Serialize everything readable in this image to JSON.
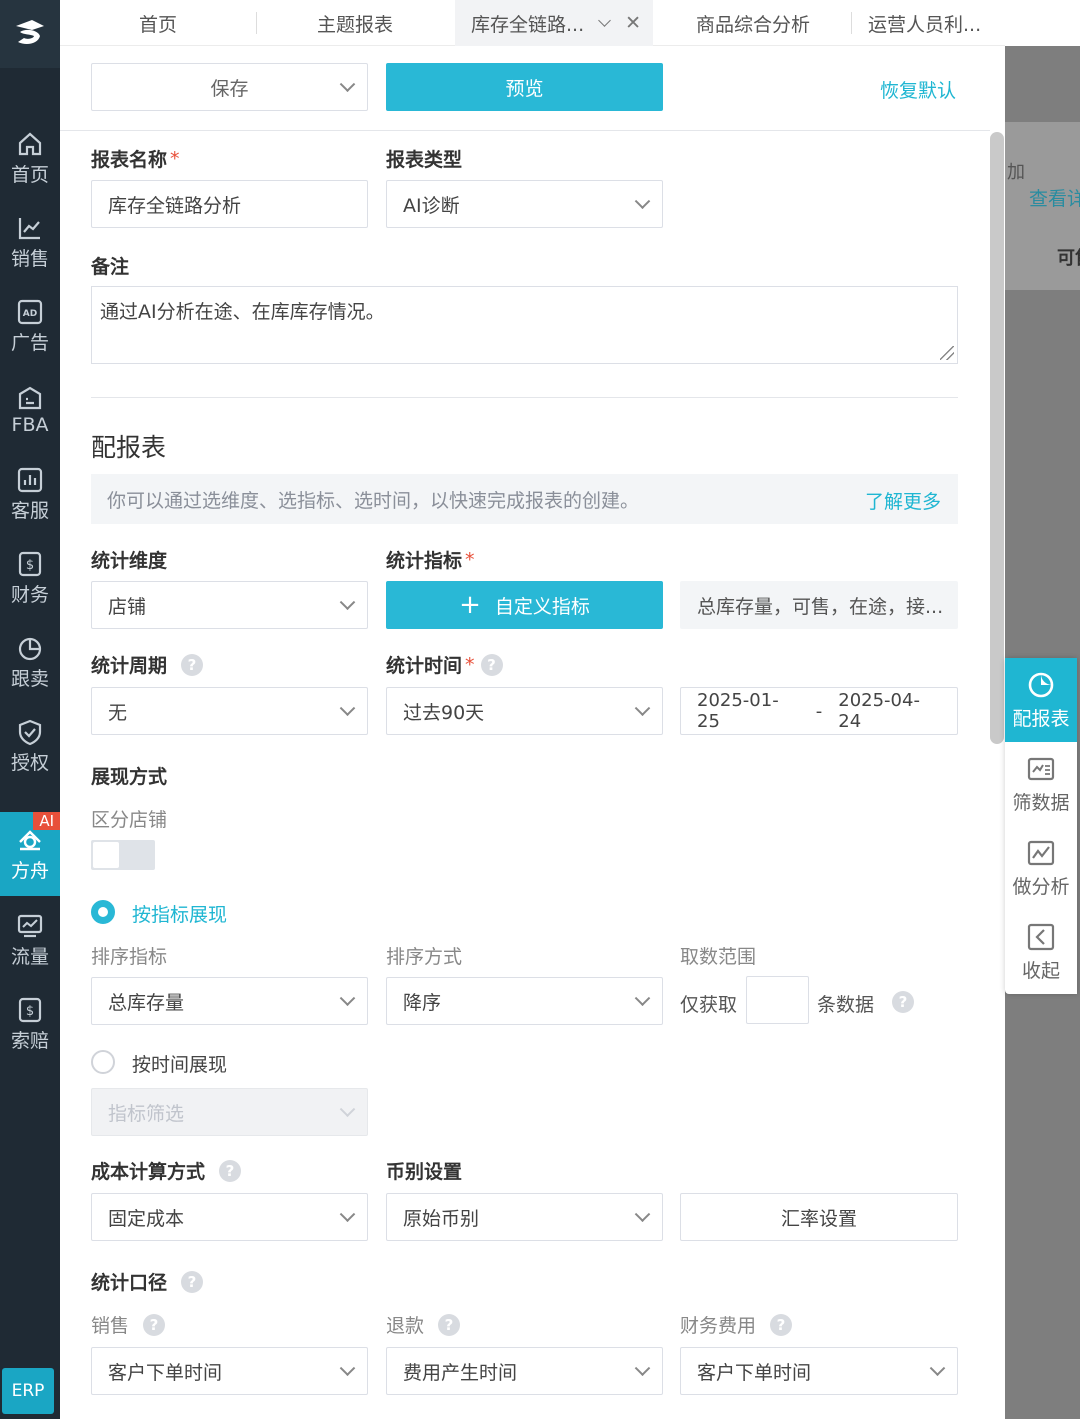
{
  "sidebar": {
    "items": [
      {
        "label": "首页",
        "icon": "home-icon"
      },
      {
        "label": "销售",
        "icon": "sales-chart-icon"
      },
      {
        "label": "广告",
        "icon": "ad-icon"
      },
      {
        "label": "FBA",
        "icon": "fba-icon"
      },
      {
        "label": "客服",
        "icon": "service-icon"
      },
      {
        "label": "财务",
        "icon": "finance-icon"
      },
      {
        "label": "跟卖",
        "icon": "pie-icon"
      },
      {
        "label": "授权",
        "icon": "shield-icon"
      },
      {
        "label": "方舟",
        "icon": "ark-icon",
        "badge": "AI"
      },
      {
        "label": "流量",
        "icon": "traffic-icon"
      },
      {
        "label": "索赔",
        "icon": "claim-icon"
      }
    ],
    "erp": "ERP"
  },
  "tabs": [
    {
      "label": "首页"
    },
    {
      "label": "主题报表"
    },
    {
      "label": "库存全链路..."
    },
    {
      "label": "商品综合分析"
    },
    {
      "label": "运营人员利..."
    }
  ],
  "toolbar": {
    "save_label": "保存",
    "preview_label": "预览",
    "restore_label": "恢复默认"
  },
  "form": {
    "report_name_label": "报表名称",
    "report_name_value": "库存全链路分析",
    "report_type_label": "报表类型",
    "report_type_value": "AI诊断",
    "remark_label": "备注",
    "remark_value": "通过AI分析在途、在库库存情况。",
    "config_title": "配报表",
    "tip_text": "你可以通过选维度、选指标、选时间，以快速完成报表的创建。",
    "learn_more": "了解更多",
    "dimension_label": "统计维度",
    "dimension_value": "店铺",
    "metric_label": "统计指标",
    "custom_metric_btn": "自定义指标",
    "metric_value": "总库存量，可售，在途，接...",
    "period_label": "统计周期",
    "period_value": "无",
    "time_label": "统计时间",
    "time_value": "过去90天",
    "date_start": "2025-01-25",
    "date_sep": "-",
    "date_end": "2025-04-24",
    "display_label": "展现方式",
    "split_store_label": "区分店铺",
    "by_metric_label": "按指标展现",
    "sort_metric_label": "排序指标",
    "sort_metric_value": "总库存量",
    "sort_order_label": "排序方式",
    "sort_order_value": "降序",
    "range_label": "取数范围",
    "range_prefix": "仅获取",
    "range_suffix": "条数据",
    "by_time_label": "按时间展现",
    "metric_filter_placeholder": "指标筛选",
    "cost_label": "成本计算方式",
    "cost_value": "固定成本",
    "currency_label": "币别设置",
    "currency_value": "原始币别",
    "rate_btn": "汇率设置",
    "caliber_label": "统计口径",
    "sales_label": "销售",
    "sales_value": "客户下单时间",
    "refund_label": "退款",
    "refund_value": "费用产生时间",
    "fin_fee_label": "财务费用",
    "fin_fee_value": "客户下单时间"
  },
  "right_panel": {
    "items": [
      {
        "label": "配报表",
        "icon": "pie-chart-icon"
      },
      {
        "label": "筛数据",
        "icon": "filter-data-icon"
      },
      {
        "label": "做分析",
        "icon": "analysis-icon"
      },
      {
        "label": "收起",
        "icon": "collapse-icon"
      }
    ]
  },
  "background_fragments": {
    "text1": "加",
    "text2": "查看详",
    "text3": "可售"
  }
}
